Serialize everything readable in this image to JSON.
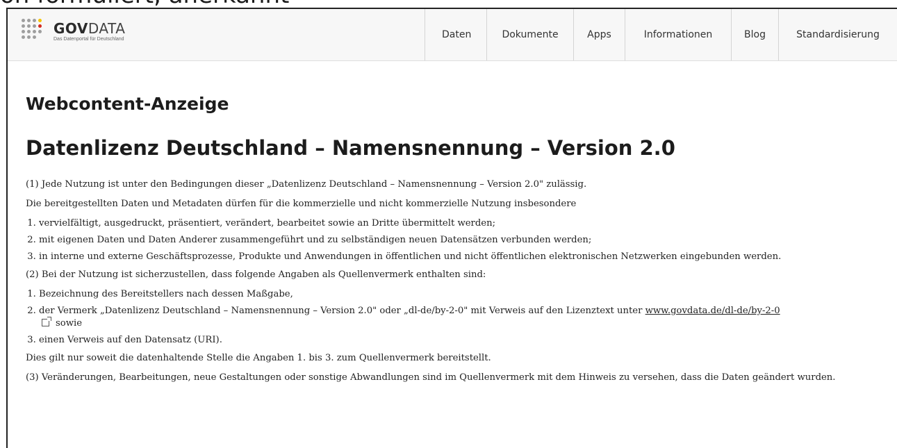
{
  "top_fragment": "on formuliert, anerkannt",
  "header": {
    "logo_name_bold": "GOV",
    "logo_name_thin": "DATA",
    "logo_tagline": "Das Datenportal für Deutschland",
    "nav": [
      {
        "label": "Daten"
      },
      {
        "label": "Dokumente"
      },
      {
        "label": "Apps"
      },
      {
        "label": "Informationen"
      },
      {
        "label": "Blog"
      },
      {
        "label": "Standardisierung"
      }
    ]
  },
  "main": {
    "portlet_title": "Webcontent-Anzeige",
    "license_title": "Datenlizenz Deutschland – Namensnennung – Version 2.0",
    "para1": "(1) Jede Nutzung ist unter den Bedingungen dieser „Datenlizenz Deutschland – Namensnennung – Version 2.0\" zulässig.",
    "para2": "Die bereitgestellten Daten und Metadaten dürfen für die kommerzielle und nicht kommerzielle Nutzung insbesondere",
    "list1": [
      "vervielfältigt, ausgedruckt, präsentiert, verändert, bearbeitet sowie an Dritte übermittelt werden;",
      "mit eigenen Daten und Daten Anderer zusammengeführt und zu selbständigen neuen Datensätzen verbunden werden;",
      "in interne und externe Geschäftsprozesse, Produkte und Anwendungen in öffentlichen und nicht öffentlichen elektronischen Netzwerken eingebunden werden."
    ],
    "para3": "(2) Bei der Nutzung ist sicherzustellen, dass folgende Angaben als Quellenvermerk enthalten sind:",
    "list2_item1": "Bezeichnung des Bereitstellers nach dessen Maßgabe,",
    "list2_item2_text": "der Vermerk „Datenlizenz Deutschland – Namensnennung – Version 2.0\" oder „dl-de/by-2-0\" mit Verweis auf den Lizenztext unter ",
    "list2_item2_link": "www.govdata.de/dl-de/by-2-0",
    "list2_item2_after": "sowie",
    "list2_item3": "einen Verweis auf den Datensatz (URI).",
    "para4": "Dies gilt nur soweit die datenhaltende Stelle die Angaben 1. bis 3. zum Quellenvermerk bereitstellt.",
    "para5": "(3) Veränderungen, Bearbeitungen, neue Gestaltungen oder sonstige Abwandlungen sind im Quellenvermerk mit dem Hinweis zu versehen, dass die Daten geändert wurden."
  },
  "colors": {
    "header_bg": "#f7f7f7",
    "logo_dot_accent": "#f5c400",
    "logo_dot_red": "#d52b1e",
    "logo_dot_grey": "#9e9e9e"
  }
}
